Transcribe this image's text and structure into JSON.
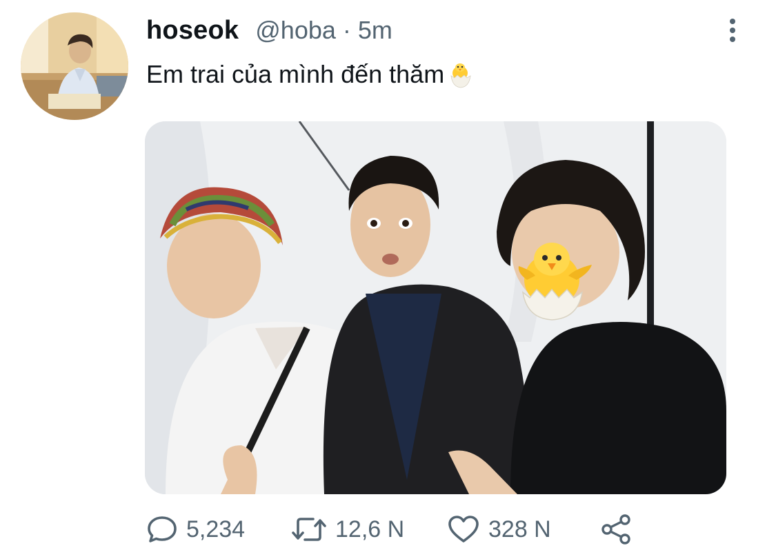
{
  "author": {
    "display_name": "hoseok",
    "handle": "@hoba",
    "separator": "·",
    "time": "5m"
  },
  "tweet": {
    "text": "Em trai của mình đến thăm",
    "trailing_emoji": "hatching-chick-emoji"
  },
  "media": {
    "type": "photo",
    "overlay_emoji": "hatching-chick-emoji"
  },
  "actions": {
    "reply": {
      "icon": "reply-icon",
      "count": "5,234"
    },
    "retweet": {
      "icon": "retweet-icon",
      "count": "12,6 N"
    },
    "like": {
      "icon": "heart-icon",
      "count": "328 N"
    },
    "share": {
      "icon": "share-icon"
    }
  },
  "more_icon": "more-vertical-icon",
  "colors": {
    "text_primary": "#0f1419",
    "text_secondary": "#536471"
  }
}
